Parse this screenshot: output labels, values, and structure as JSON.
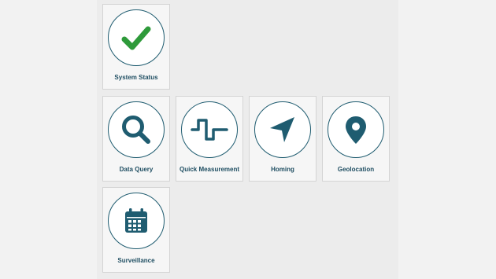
{
  "tiles": [
    {
      "label": "System Status",
      "icon": "check-icon"
    },
    {
      "label": "Data Query",
      "icon": "search-icon"
    },
    {
      "label": "Quick Measurement",
      "icon": "signal-wave-icon"
    },
    {
      "label": "Homing",
      "icon": "navigation-arrow-icon"
    },
    {
      "label": "Geolocation",
      "icon": "map-pin-icon"
    },
    {
      "label": "Surveillance",
      "icon": "calendar-icon"
    }
  ],
  "colors": {
    "accent": "#1f5c70",
    "check": "#2e9a3a",
    "label": "#1f4e62"
  }
}
